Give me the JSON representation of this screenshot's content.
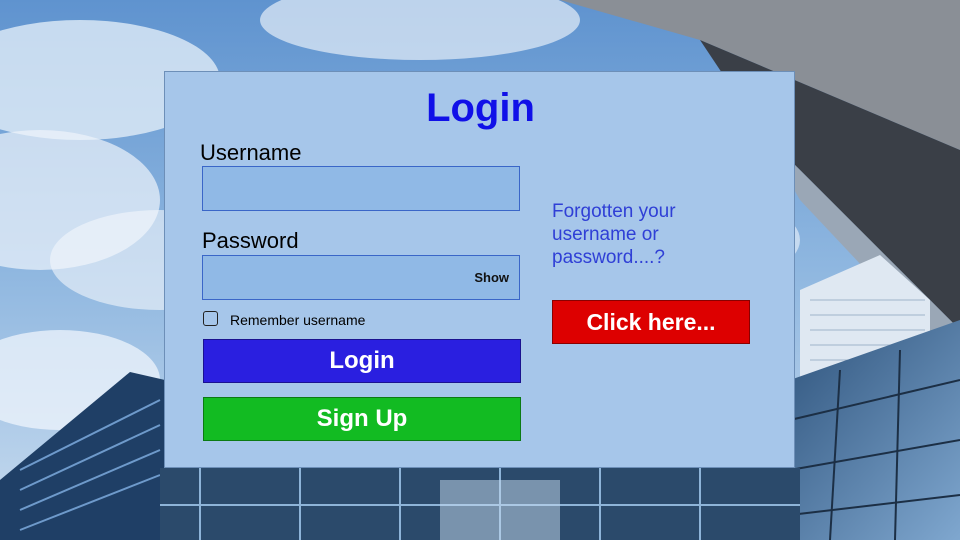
{
  "login_form": {
    "title": "Login",
    "username": {
      "label": "Username",
      "value": "",
      "placeholder": ""
    },
    "password": {
      "label": "Password",
      "value": "",
      "placeholder": "",
      "show_label": "Show"
    },
    "remember": {
      "label": "Remember username",
      "checked": false
    },
    "login_button": "Login",
    "signup_button": "Sign Up"
  },
  "recovery": {
    "prompt": "Forgotten your username or password....?",
    "button": "Click here..."
  },
  "colors": {
    "panel_bg": "#a6c6ea",
    "title": "#1010e8",
    "login_button": "#2a1fe0",
    "signup_button": "#12bb22",
    "recovery_button": "#dd0000",
    "recovery_text": "#2f3fd6"
  }
}
